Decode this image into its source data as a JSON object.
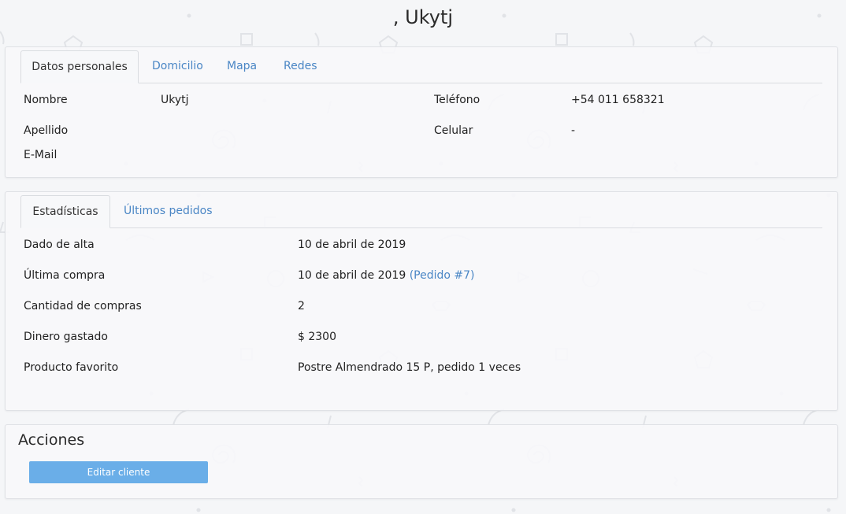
{
  "page": {
    "title": ", Ukytj"
  },
  "personal": {
    "tabs": [
      "Datos personales",
      "Domicilio",
      "Mapa",
      "Redes"
    ],
    "nombre_label": "Nombre",
    "nombre_value": "Ukytj",
    "apellido_label": "Apellido",
    "apellido_value": "",
    "email_label": "E-Mail",
    "email_value": "",
    "telefono_label": "Teléfono",
    "telefono_value": "+54 011 658321",
    "celular_label": "Celular",
    "celular_value": "-"
  },
  "stats": {
    "tabs": [
      "Estadísticas",
      "Últimos pedidos"
    ],
    "rows": [
      {
        "label": "Dado de alta",
        "value": "10 de abril de 2019",
        "link": ""
      },
      {
        "label": "Última compra",
        "value": "10 de abril de 2019",
        "link": "(Pedido #7)"
      },
      {
        "label": "Cantidad de compras",
        "value": "2",
        "link": ""
      },
      {
        "label": "Dinero gastado",
        "value": "$ 2300",
        "link": ""
      },
      {
        "label": "Producto favorito",
        "value": "Postre Almendrado 15 P, pedido 1 veces",
        "link": ""
      }
    ]
  },
  "actions": {
    "title": "Acciones",
    "edit_button": "Editar cliente"
  },
  "colors": {
    "link": "#4a86c5",
    "button": "#6aaee8",
    "background": "#f5f6f8"
  }
}
